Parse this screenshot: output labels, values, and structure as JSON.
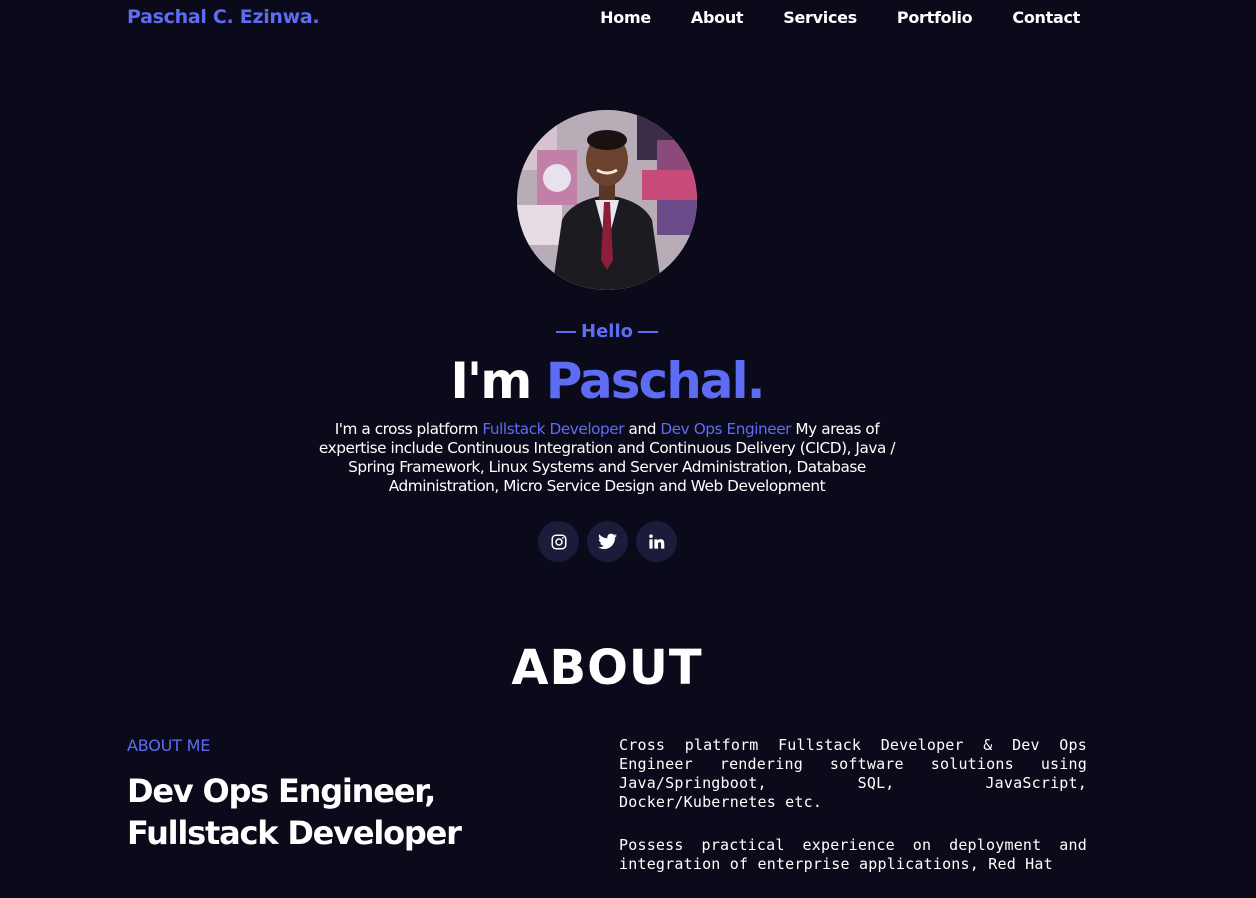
{
  "header": {
    "logo": "Paschal C. Ezinwa.",
    "nav": [
      "Home",
      "About",
      "Services",
      "Portfolio",
      "Contact"
    ]
  },
  "hero": {
    "greeting": "Hello",
    "title_prefix": "I'm",
    "title_name": "Paschal.",
    "intro": {
      "part1": "I'm a cross platform ",
      "role1": "Fullstack Developer",
      "part2": " and ",
      "role2": "Dev Ops Engineer",
      "part3": " My areas of expertise include Continuous Integration and Continuous Delivery (CICD), Java / Spring Framework, Linux Systems and Server Administration, Database Administration, Micro Service Design and Web Development"
    },
    "socials": [
      "instagram-icon",
      "twitter-icon",
      "linkedin-icon"
    ]
  },
  "about": {
    "heading": "ABOUT",
    "label": "ABOUT ME",
    "role": "Dev Ops Engineer, Fullstack Developer",
    "paragraphs": [
      "Cross platform Fullstack Developer & Dev Ops Engineer rendering software solutions using Java/Springboot, SQL, JavaScript, Docker/Kubernetes etc.",
      "Possess practical experience on deployment and integration of enterprise applications, Red Hat"
    ]
  },
  "colors": {
    "background": "#0a0a1a",
    "accent": "#5d6cf3",
    "social_bg": "#1b1c3b"
  }
}
